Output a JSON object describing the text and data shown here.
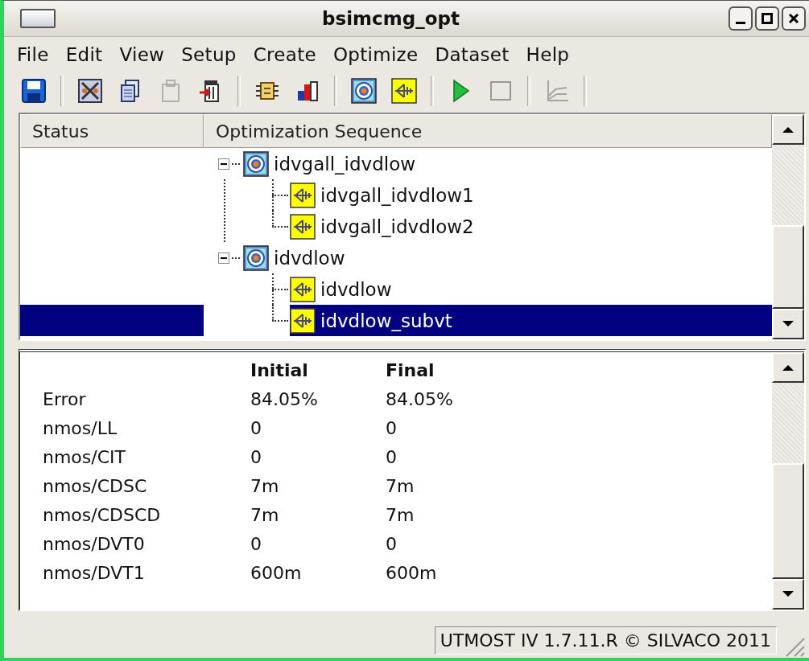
{
  "window": {
    "title": "bsimcmg_opt"
  },
  "menu": [
    "File",
    "Edit",
    "View",
    "Setup",
    "Create",
    "Optimize",
    "Dataset",
    "Help"
  ],
  "toolbar": [
    {
      "kind": "save",
      "disabled": false
    },
    {
      "kind": "sep"
    },
    {
      "kind": "cut",
      "disabled": false
    },
    {
      "kind": "copy",
      "disabled": false
    },
    {
      "kind": "paste",
      "disabled": true
    },
    {
      "kind": "delete",
      "disabled": false
    },
    {
      "kind": "sep"
    },
    {
      "kind": "setup",
      "disabled": false
    },
    {
      "kind": "dataset",
      "disabled": false
    },
    {
      "kind": "sep"
    },
    {
      "kind": "optimization",
      "disabled": false
    },
    {
      "kind": "step",
      "disabled": false
    },
    {
      "kind": "sep"
    },
    {
      "kind": "run",
      "disabled": false
    },
    {
      "kind": "stop",
      "disabled": true
    },
    {
      "kind": "sep"
    },
    {
      "kind": "plot",
      "disabled": true
    },
    {
      "kind": "sep"
    }
  ],
  "tree": {
    "columns": [
      "Status",
      "Optimization Sequence"
    ],
    "items": [
      {
        "label": "idvgall_idvdlow",
        "kind": "optimization",
        "expanded": true,
        "selected": false,
        "children": [
          {
            "label": "idvgall_idvdlow1",
            "kind": "step",
            "selected": false
          },
          {
            "label": "idvgall_idvdlow2",
            "kind": "step",
            "selected": false
          }
        ]
      },
      {
        "label": "idvdlow",
        "kind": "optimization",
        "expanded": true,
        "selected": false,
        "children": [
          {
            "label": "idvdlow",
            "kind": "step",
            "selected": false
          },
          {
            "label": "idvdlow_subvt",
            "kind": "step",
            "selected": true
          }
        ]
      }
    ]
  },
  "results": {
    "columns": [
      "Initial",
      "Final"
    ],
    "rows": [
      {
        "name": "Error",
        "initial": "84.05%",
        "final": "84.05%"
      },
      {
        "name": "nmos/LL",
        "initial": "0",
        "final": "0"
      },
      {
        "name": "nmos/CIT",
        "initial": "0",
        "final": "0"
      },
      {
        "name": "nmos/CDSC",
        "initial": "7m",
        "final": "7m"
      },
      {
        "name": "nmos/CDSCD",
        "initial": "7m",
        "final": "7m"
      },
      {
        "name": "nmos/DVT0",
        "initial": "0",
        "final": "0"
      },
      {
        "name": "nmos/DVT1",
        "initial": "600m",
        "final": "600m"
      }
    ]
  },
  "status_bar": {
    "text": "UTMOST IV 1.7.11.R © SILVACO 2011"
  }
}
